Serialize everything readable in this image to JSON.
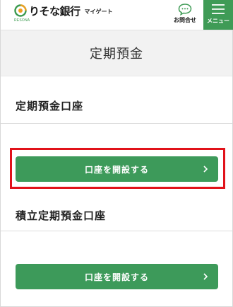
{
  "header": {
    "logo_text": "りそな銀行",
    "logo_sub": "RESONA",
    "logo_app": "マイゲート",
    "contact_label": "お問合せ",
    "menu_label": "メニュー"
  },
  "page": {
    "title": "定期預金"
  },
  "sections": [
    {
      "heading": "定期預金口座",
      "button_label": "口座を開設する"
    },
    {
      "heading": "積立定期預金口座",
      "button_label": "口座を開設する"
    }
  ],
  "colors": {
    "brand_green": "#3d9a5a",
    "highlight_red": "#e1121a",
    "title_band": "#f2f2f2"
  },
  "icons": {
    "logo": "resona-logo-icon",
    "contact": "chat-bubble-icon",
    "menu": "hamburger-icon",
    "chevron": "chevron-right-icon"
  }
}
